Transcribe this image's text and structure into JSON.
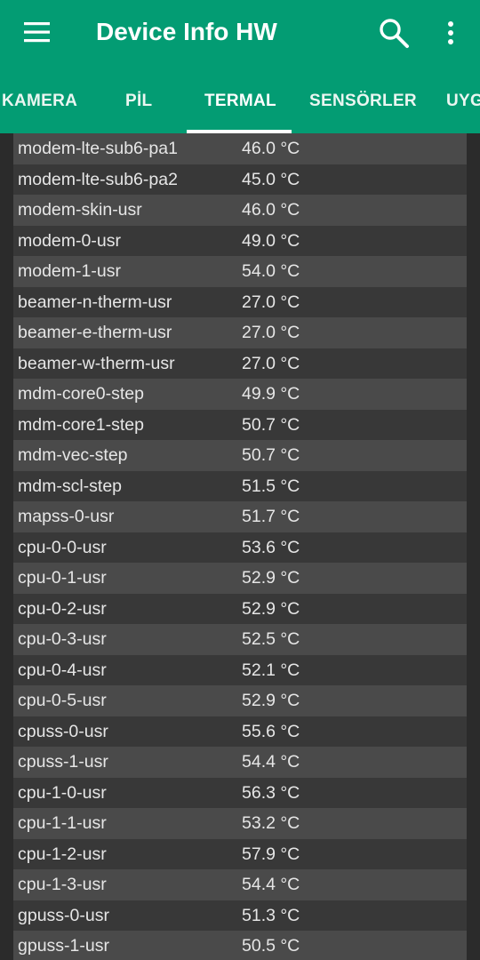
{
  "app": {
    "title": "Device Info HW",
    "icons": {
      "menu": "hamburger-menu-icon",
      "search": "search-icon",
      "more": "more-vert-icon"
    },
    "colors": {
      "toolbar": "#039c73",
      "background": "#2b2b2b",
      "row_light": "#4a4a4a",
      "row_dark": "#383838",
      "text": "#e6e6e6"
    }
  },
  "tabs": [
    {
      "label": "KAMERA"
    },
    {
      "label": "PİL"
    },
    {
      "label": "TERMAL",
      "active": true
    },
    {
      "label": "SENSÖRLER"
    },
    {
      "label": "UYG"
    }
  ],
  "thermal": [
    {
      "name": "modem-lte-sub6-pa1",
      "value": "46.0 °C"
    },
    {
      "name": "modem-lte-sub6-pa2",
      "value": "45.0 °C"
    },
    {
      "name": "modem-skin-usr",
      "value": "46.0 °C"
    },
    {
      "name": "modem-0-usr",
      "value": "49.0 °C"
    },
    {
      "name": "modem-1-usr",
      "value": "54.0 °C"
    },
    {
      "name": "beamer-n-therm-usr",
      "value": "27.0 °C"
    },
    {
      "name": "beamer-e-therm-usr",
      "value": "27.0 °C"
    },
    {
      "name": "beamer-w-therm-usr",
      "value": "27.0 °C"
    },
    {
      "name": "mdm-core0-step",
      "value": "49.9 °C"
    },
    {
      "name": "mdm-core1-step",
      "value": "50.7 °C"
    },
    {
      "name": "mdm-vec-step",
      "value": "50.7 °C"
    },
    {
      "name": "mdm-scl-step",
      "value": "51.5 °C"
    },
    {
      "name": "mapss-0-usr",
      "value": "51.7 °C"
    },
    {
      "name": "cpu-0-0-usr",
      "value": "53.6 °C"
    },
    {
      "name": "cpu-0-1-usr",
      "value": "52.9 °C"
    },
    {
      "name": "cpu-0-2-usr",
      "value": "52.9 °C"
    },
    {
      "name": "cpu-0-3-usr",
      "value": "52.5 °C"
    },
    {
      "name": "cpu-0-4-usr",
      "value": "52.1 °C"
    },
    {
      "name": "cpu-0-5-usr",
      "value": "52.9 °C"
    },
    {
      "name": "cpuss-0-usr",
      "value": "55.6 °C"
    },
    {
      "name": "cpuss-1-usr",
      "value": "54.4 °C"
    },
    {
      "name": "cpu-1-0-usr",
      "value": "56.3 °C"
    },
    {
      "name": "cpu-1-1-usr",
      "value": "53.2 °C"
    },
    {
      "name": "cpu-1-2-usr",
      "value": "57.9 °C"
    },
    {
      "name": "cpu-1-3-usr",
      "value": "54.4 °C"
    },
    {
      "name": "gpuss-0-usr",
      "value": "51.3 °C"
    },
    {
      "name": "gpuss-1-usr",
      "value": "50.5 °C"
    }
  ]
}
